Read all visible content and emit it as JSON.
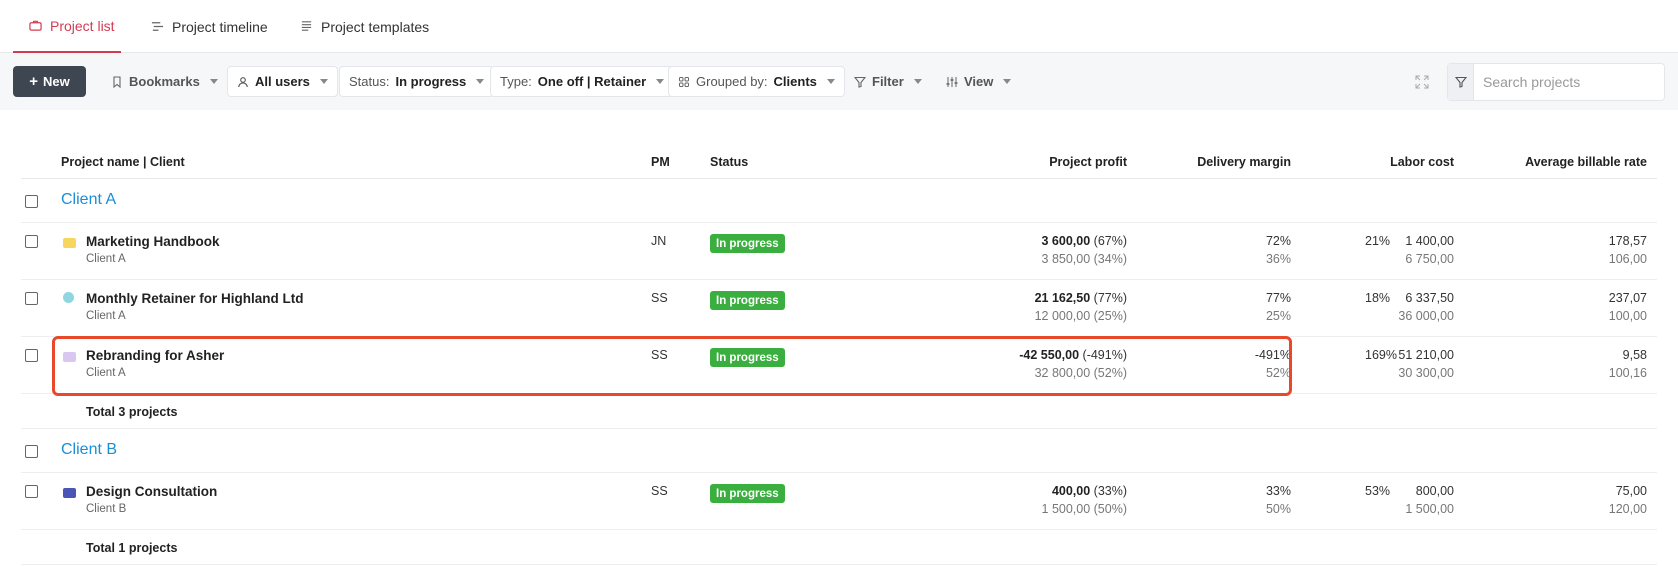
{
  "tabs": [
    {
      "label": "Project list",
      "icon": "briefcase-icon",
      "active": true
    },
    {
      "label": "Project timeline",
      "icon": "timeline-icon",
      "active": false
    },
    {
      "label": "Project templates",
      "icon": "templates-icon",
      "active": false
    }
  ],
  "toolbar": {
    "new_label": "New",
    "bookmarks_label": "Bookmarks",
    "users_label": "All users",
    "status_prefix": "Status:",
    "status_value": "In progress",
    "type_prefix": "Type:",
    "type_value": "One off | Retainer",
    "grouped_prefix": "Grouped by:",
    "grouped_value": "Clients",
    "filter_label": "Filter",
    "view_label": "View",
    "search_placeholder": "Search projects"
  },
  "columns": {
    "name": "Project name | Client",
    "pm": "PM",
    "status": "Status",
    "profit": "Project profit",
    "margin": "Delivery margin",
    "labor": "Labor cost",
    "rate": "Average billable rate"
  },
  "groups": [
    {
      "name": "Client A",
      "total": "Total 3 projects",
      "projects": [
        {
          "name": "Marketing Handbook",
          "client": "Client A",
          "pm": "JN",
          "status": "In progress",
          "icon_color": "#f7d660",
          "profit_main": "3 600,00",
          "profit_pct": "(67%)",
          "profit_sub": "3 850,00 (34%)",
          "margin_main": "72%",
          "margin_sub": "36%",
          "labor_main": "1 400,00",
          "labor_sub": "6 750,00",
          "labor_pct": "21%",
          "rate_main": "178,57",
          "rate_sub": "106,00"
        },
        {
          "name": "Monthly Retainer for Highland Ltd",
          "client": "Client A",
          "pm": "SS",
          "status": "In progress",
          "icon_color": "#8fd6df",
          "profit_main": "21 162,50",
          "profit_pct": "(77%)",
          "profit_sub": "12 000,00 (25%)",
          "margin_main": "77%",
          "margin_sub": "25%",
          "labor_main": "6 337,50",
          "labor_sub": "36 000,00",
          "labor_pct": "18%",
          "rate_main": "237,07",
          "rate_sub": "100,00"
        },
        {
          "name": "Rebranding for Asher",
          "client": "Client A",
          "pm": "SS",
          "status": "In progress",
          "icon_color": "#d9c7f2",
          "profit_main": "-42 550,00",
          "profit_pct": "(-491%)",
          "profit_sub": "32 800,00 (52%)",
          "margin_main": "-491%",
          "margin_sub": "52%",
          "labor_main": "51 210,00",
          "labor_sub": "30 300,00",
          "labor_pct": "169%",
          "rate_main": "9,58",
          "rate_sub": "100,16"
        }
      ]
    },
    {
      "name": "Client B",
      "total": "Total 1 projects",
      "projects": [
        {
          "name": "Design Consultation",
          "client": "Client B",
          "pm": "SS",
          "status": "In progress",
          "icon_color": "#4a55b8",
          "profit_main": "400,00",
          "profit_pct": "(33%)",
          "profit_sub": "1 500,00 (50%)",
          "margin_main": "33%",
          "margin_sub": "50%",
          "labor_main": "800,00",
          "labor_sub": "1 500,00",
          "labor_pct": "53%",
          "rate_main": "75,00",
          "rate_sub": "120,00"
        }
      ]
    }
  ],
  "colors": {
    "accent": "#d43b52",
    "status_green": "#3aae3e",
    "group_blue": "#1a8fd6",
    "highlight": "#e8492a"
  }
}
